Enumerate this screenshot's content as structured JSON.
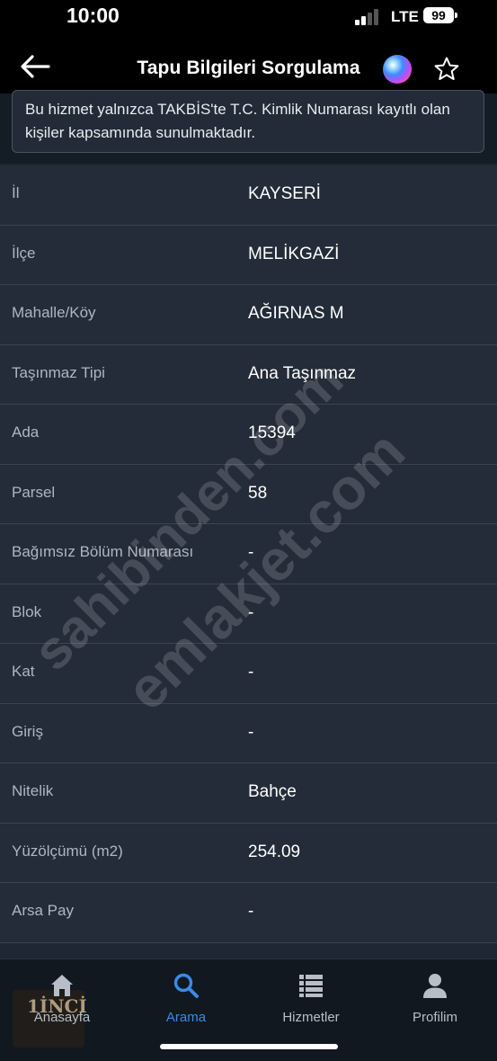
{
  "status_bar": {
    "time": "10:00",
    "network": "LTE",
    "battery": "99"
  },
  "header": {
    "title": "Tapu Bilgileri Sorgulama",
    "icons": [
      "back-arrow-icon",
      "siri-icon",
      "star-icon"
    ]
  },
  "notice": {
    "text": "Bu hizmet yalnızca TAKBİS'te T.C. Kimlik Numarası kayıtlı olan kişiler kapsamında sunulmaktadır."
  },
  "info_rows": [
    {
      "label": "İl",
      "value": "KAYSERİ"
    },
    {
      "label": "İlçe",
      "value": "MELİKGAZİ"
    },
    {
      "label": "Mahalle/Köy",
      "value": "AĞIRNAS M"
    },
    {
      "label": "Taşınmaz Tipi",
      "value": "Ana Taşınmaz"
    },
    {
      "label": "Ada",
      "value": "15394"
    },
    {
      "label": "Parsel",
      "value": "58"
    },
    {
      "label": "Bağımsız Bölüm Numarası",
      "value": "-"
    },
    {
      "label": "Blok",
      "value": "-"
    },
    {
      "label": "Kat",
      "value": "-"
    },
    {
      "label": "Giriş",
      "value": "-"
    },
    {
      "label": "Nitelik",
      "value": "Bahçe"
    },
    {
      "label": "Yüzölçümü (m2)",
      "value": "254.09"
    },
    {
      "label": "Arsa Pay",
      "value": "-"
    }
  ],
  "watermarks": [
    "sahibinden.com",
    "emlakjet.com"
  ],
  "tab_bar": {
    "tabs": [
      {
        "label": "Anasayfa",
        "icon": "home-icon"
      },
      {
        "label": "Arama",
        "icon": "search-icon",
        "active": true
      },
      {
        "label": "Hizmetler",
        "icon": "list-icon"
      },
      {
        "label": "Profilim",
        "icon": "person-icon"
      }
    ],
    "logo_text": "1İNCİ"
  },
  "colors": {
    "accent": "#3a8be6",
    "background": "#1e2733",
    "row_background": "#232c38",
    "label": "#aeb6c0"
  }
}
